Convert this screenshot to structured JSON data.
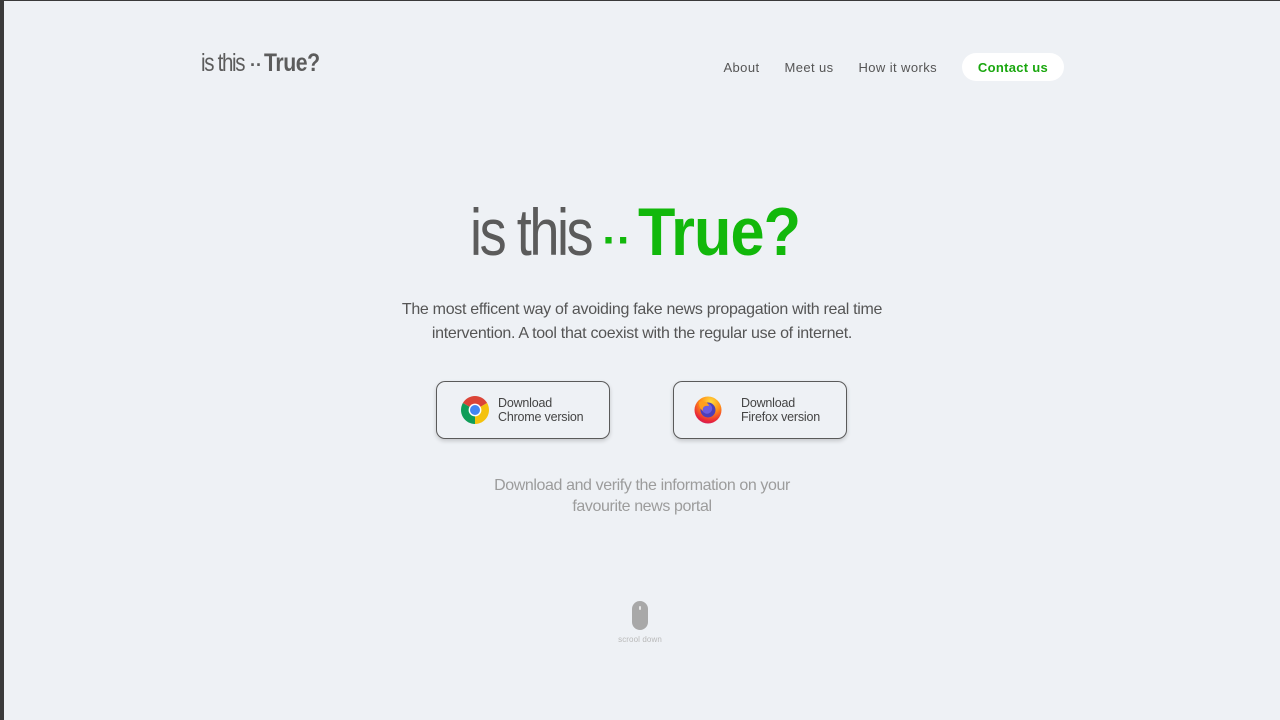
{
  "header": {
    "logo": {
      "part1": "is this",
      "dots": "··",
      "part2": "True?"
    },
    "nav": [
      {
        "label": "About"
      },
      {
        "label": "Meet us"
      },
      {
        "label": "How it works"
      }
    ],
    "contact_label": "Contact us"
  },
  "hero": {
    "title": {
      "part1": "is this",
      "dots": "··",
      "part2": "True?"
    },
    "tagline": [
      "The most efficent way of avoiding fake news propagation with real time",
      "intervention. A tool that coexist with the regular use of internet."
    ],
    "buttons": {
      "chrome": {
        "line1": "Download",
        "line2": "Chrome version",
        "icon": "chrome-icon"
      },
      "firefox": {
        "line1": "Download",
        "line2": "Firefox version",
        "icon": "firefox-icon"
      }
    },
    "subtext": [
      "Download and verify the information on your",
      "favourite news portal"
    ],
    "scroll_label": "scrool down"
  },
  "colors": {
    "accent": "#12b80b",
    "background": "#eef1f5",
    "text_dark": "#5b5b5b"
  }
}
